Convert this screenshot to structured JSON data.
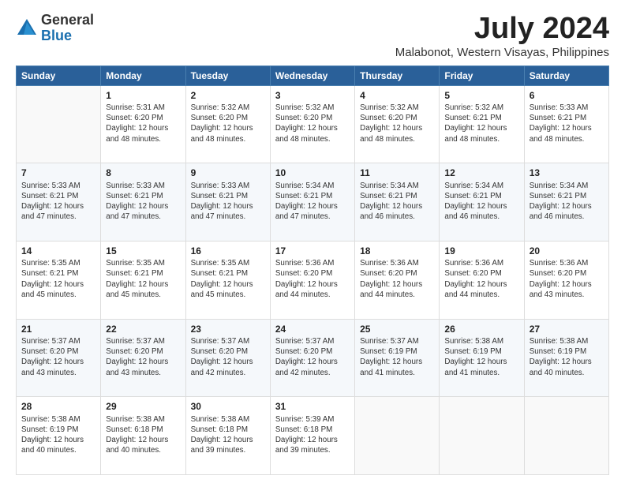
{
  "logo": {
    "general": "General",
    "blue": "Blue"
  },
  "title": "July 2024",
  "subtitle": "Malabonot, Western Visayas, Philippines",
  "days_header": [
    "Sunday",
    "Monday",
    "Tuesday",
    "Wednesday",
    "Thursday",
    "Friday",
    "Saturday"
  ],
  "weeks": [
    [
      {
        "num": "",
        "sunrise": "",
        "sunset": "",
        "daylight": ""
      },
      {
        "num": "1",
        "sunrise": "Sunrise: 5:31 AM",
        "sunset": "Sunset: 6:20 PM",
        "daylight": "Daylight: 12 hours and 48 minutes."
      },
      {
        "num": "2",
        "sunrise": "Sunrise: 5:32 AM",
        "sunset": "Sunset: 6:20 PM",
        "daylight": "Daylight: 12 hours and 48 minutes."
      },
      {
        "num": "3",
        "sunrise": "Sunrise: 5:32 AM",
        "sunset": "Sunset: 6:20 PM",
        "daylight": "Daylight: 12 hours and 48 minutes."
      },
      {
        "num": "4",
        "sunrise": "Sunrise: 5:32 AM",
        "sunset": "Sunset: 6:20 PM",
        "daylight": "Daylight: 12 hours and 48 minutes."
      },
      {
        "num": "5",
        "sunrise": "Sunrise: 5:32 AM",
        "sunset": "Sunset: 6:21 PM",
        "daylight": "Daylight: 12 hours and 48 minutes."
      },
      {
        "num": "6",
        "sunrise": "Sunrise: 5:33 AM",
        "sunset": "Sunset: 6:21 PM",
        "daylight": "Daylight: 12 hours and 48 minutes."
      }
    ],
    [
      {
        "num": "7",
        "sunrise": "Sunrise: 5:33 AM",
        "sunset": "Sunset: 6:21 PM",
        "daylight": "Daylight: 12 hours and 47 minutes."
      },
      {
        "num": "8",
        "sunrise": "Sunrise: 5:33 AM",
        "sunset": "Sunset: 6:21 PM",
        "daylight": "Daylight: 12 hours and 47 minutes."
      },
      {
        "num": "9",
        "sunrise": "Sunrise: 5:33 AM",
        "sunset": "Sunset: 6:21 PM",
        "daylight": "Daylight: 12 hours and 47 minutes."
      },
      {
        "num": "10",
        "sunrise": "Sunrise: 5:34 AM",
        "sunset": "Sunset: 6:21 PM",
        "daylight": "Daylight: 12 hours and 47 minutes."
      },
      {
        "num": "11",
        "sunrise": "Sunrise: 5:34 AM",
        "sunset": "Sunset: 6:21 PM",
        "daylight": "Daylight: 12 hours and 46 minutes."
      },
      {
        "num": "12",
        "sunrise": "Sunrise: 5:34 AM",
        "sunset": "Sunset: 6:21 PM",
        "daylight": "Daylight: 12 hours and 46 minutes."
      },
      {
        "num": "13",
        "sunrise": "Sunrise: 5:34 AM",
        "sunset": "Sunset: 6:21 PM",
        "daylight": "Daylight: 12 hours and 46 minutes."
      }
    ],
    [
      {
        "num": "14",
        "sunrise": "Sunrise: 5:35 AM",
        "sunset": "Sunset: 6:21 PM",
        "daylight": "Daylight: 12 hours and 45 minutes."
      },
      {
        "num": "15",
        "sunrise": "Sunrise: 5:35 AM",
        "sunset": "Sunset: 6:21 PM",
        "daylight": "Daylight: 12 hours and 45 minutes."
      },
      {
        "num": "16",
        "sunrise": "Sunrise: 5:35 AM",
        "sunset": "Sunset: 6:21 PM",
        "daylight": "Daylight: 12 hours and 45 minutes."
      },
      {
        "num": "17",
        "sunrise": "Sunrise: 5:36 AM",
        "sunset": "Sunset: 6:20 PM",
        "daylight": "Daylight: 12 hours and 44 minutes."
      },
      {
        "num": "18",
        "sunrise": "Sunrise: 5:36 AM",
        "sunset": "Sunset: 6:20 PM",
        "daylight": "Daylight: 12 hours and 44 minutes."
      },
      {
        "num": "19",
        "sunrise": "Sunrise: 5:36 AM",
        "sunset": "Sunset: 6:20 PM",
        "daylight": "Daylight: 12 hours and 44 minutes."
      },
      {
        "num": "20",
        "sunrise": "Sunrise: 5:36 AM",
        "sunset": "Sunset: 6:20 PM",
        "daylight": "Daylight: 12 hours and 43 minutes."
      }
    ],
    [
      {
        "num": "21",
        "sunrise": "Sunrise: 5:37 AM",
        "sunset": "Sunset: 6:20 PM",
        "daylight": "Daylight: 12 hours and 43 minutes."
      },
      {
        "num": "22",
        "sunrise": "Sunrise: 5:37 AM",
        "sunset": "Sunset: 6:20 PM",
        "daylight": "Daylight: 12 hours and 43 minutes."
      },
      {
        "num": "23",
        "sunrise": "Sunrise: 5:37 AM",
        "sunset": "Sunset: 6:20 PM",
        "daylight": "Daylight: 12 hours and 42 minutes."
      },
      {
        "num": "24",
        "sunrise": "Sunrise: 5:37 AM",
        "sunset": "Sunset: 6:20 PM",
        "daylight": "Daylight: 12 hours and 42 minutes."
      },
      {
        "num": "25",
        "sunrise": "Sunrise: 5:37 AM",
        "sunset": "Sunset: 6:19 PM",
        "daylight": "Daylight: 12 hours and 41 minutes."
      },
      {
        "num": "26",
        "sunrise": "Sunrise: 5:38 AM",
        "sunset": "Sunset: 6:19 PM",
        "daylight": "Daylight: 12 hours and 41 minutes."
      },
      {
        "num": "27",
        "sunrise": "Sunrise: 5:38 AM",
        "sunset": "Sunset: 6:19 PM",
        "daylight": "Daylight: 12 hours and 40 minutes."
      }
    ],
    [
      {
        "num": "28",
        "sunrise": "Sunrise: 5:38 AM",
        "sunset": "Sunset: 6:19 PM",
        "daylight": "Daylight: 12 hours and 40 minutes."
      },
      {
        "num": "29",
        "sunrise": "Sunrise: 5:38 AM",
        "sunset": "Sunset: 6:18 PM",
        "daylight": "Daylight: 12 hours and 40 minutes."
      },
      {
        "num": "30",
        "sunrise": "Sunrise: 5:38 AM",
        "sunset": "Sunset: 6:18 PM",
        "daylight": "Daylight: 12 hours and 39 minutes."
      },
      {
        "num": "31",
        "sunrise": "Sunrise: 5:39 AM",
        "sunset": "Sunset: 6:18 PM",
        "daylight": "Daylight: 12 hours and 39 minutes."
      },
      {
        "num": "",
        "sunrise": "",
        "sunset": "",
        "daylight": ""
      },
      {
        "num": "",
        "sunrise": "",
        "sunset": "",
        "daylight": ""
      },
      {
        "num": "",
        "sunrise": "",
        "sunset": "",
        "daylight": ""
      }
    ]
  ]
}
